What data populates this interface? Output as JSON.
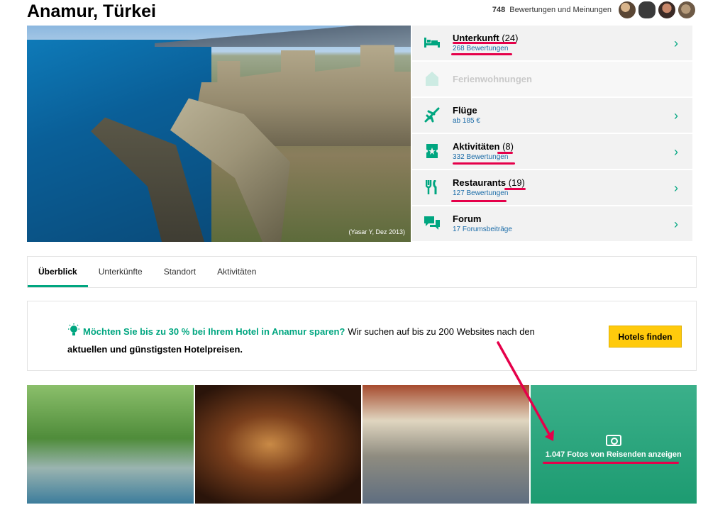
{
  "header": {
    "title": "Anamur, Türkei",
    "review_count": "748",
    "review_text": "Bewertungen und Meinungen"
  },
  "hero": {
    "credit": "(Yasar Y, Dez 2013)"
  },
  "categories": [
    {
      "name": "Unterkunft",
      "count": "(24)",
      "sub": "268 Bewertungen",
      "icon": "bed-icon"
    },
    {
      "name": "Ferienwohnungen",
      "count": "",
      "sub": "",
      "icon": "house-icon",
      "disabled": true
    },
    {
      "name": "Flüge",
      "count": "",
      "sub": "ab 185 €",
      "icon": "plane-icon"
    },
    {
      "name": "Aktivitäten",
      "count": "(8)",
      "sub": "332 Bewertungen",
      "icon": "ticket-icon"
    },
    {
      "name": "Restaurants",
      "count": "(19)",
      "sub": "127 Bewertungen",
      "icon": "cutlery-icon"
    },
    {
      "name": "Forum",
      "count": "",
      "sub": "17  Forumsbeiträge",
      "icon": "chat-icon"
    }
  ],
  "tabs": [
    "Überblick",
    "Unterkünfte",
    "Standort",
    "Aktivitäten"
  ],
  "promo": {
    "highlight": "Möchten Sie bis zu 30 % bei Ihrem Hotel in Anamur sparen?",
    "text": "Wir suchen auf bis zu 200 Websites nach den",
    "text2": "aktuellen und günstigsten Hotelpreisen.",
    "button": "Hotels finden"
  },
  "photos": {
    "more_label": "1.047 Fotos von Reisenden anzeigen"
  },
  "colors": {
    "accent": "#00a680",
    "link": "#1b6ca8",
    "annotation": "#e5004a",
    "button": "#ffca0c"
  }
}
